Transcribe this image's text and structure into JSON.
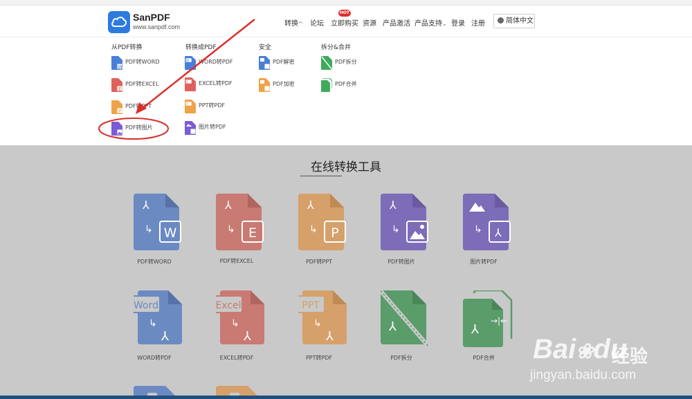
{
  "header": {
    "logo_name": "SanPDF",
    "logo_url": "www.sanpdf.com",
    "nav": [
      "转换",
      "论坛",
      "立即购买",
      "资源",
      "产品激活",
      "产品支持",
      "登录",
      "注册"
    ],
    "hot_badge": "HOT",
    "language": "简体中文"
  },
  "dropdown": {
    "columns": [
      {
        "title": "从PDF转换",
        "items": [
          "PDF转WORD",
          "PDF转EXCEL",
          "PDF转PPT",
          "PDF转图片"
        ]
      },
      {
        "title": "转换成PDF",
        "items": [
          "WORD转PDF",
          "EXCEL转PDF",
          "PPT转PDF",
          "图片转PDF"
        ]
      },
      {
        "title": "安全",
        "items": [
          "PDF解密",
          "PDF加密"
        ]
      },
      {
        "title": "拆分&合并",
        "items": [
          "PDF拆分",
          "PDF合并"
        ]
      }
    ]
  },
  "tools_section": {
    "title": "在线转换工具",
    "tools": [
      {
        "label": "PDF转WORD",
        "badge": "W"
      },
      {
        "label": "PDF转EXCEL",
        "badge": "E"
      },
      {
        "label": "PDF转PPT",
        "badge": "P"
      },
      {
        "label": "PDF转图片",
        "badge": ""
      },
      {
        "label": "图片转PDF",
        "badge": ""
      },
      {
        "label": "WORD转PDF",
        "badge": "Word"
      },
      {
        "label": "EXCEL转PDF",
        "badge": "Excel"
      },
      {
        "label": "PPT转PDF",
        "badge": "PPT"
      },
      {
        "label": "PDF拆分",
        "badge": ""
      },
      {
        "label": "PDF合并",
        "badge": ""
      }
    ]
  },
  "watermark": {
    "brand": "Bai",
    "brand_tail": "du",
    "brand_cn": "经验",
    "url": "jingyan.baidu.com"
  },
  "colors": {
    "accent": "#2e7be0",
    "word_blue": "#4a7fd8",
    "excel_red": "#e0615c",
    "ppt_orange": "#f0a24a",
    "image_purple": "#7b5bd6",
    "split_green": "#3faa5c",
    "annotation_red": "#d9302c",
    "overlay_gray": "#c9c9c9"
  }
}
